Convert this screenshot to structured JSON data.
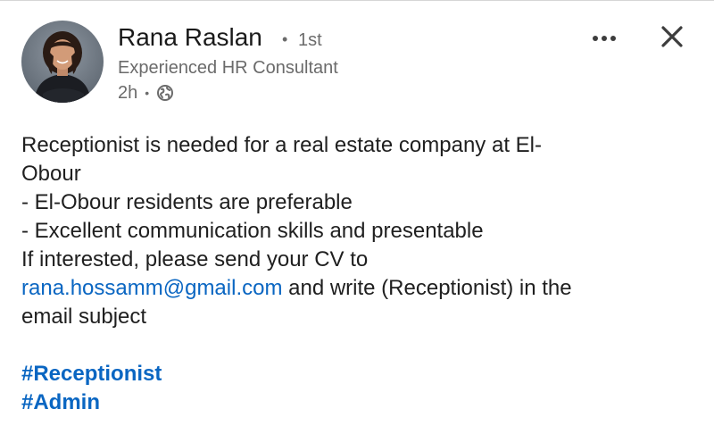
{
  "post": {
    "author": {
      "name": "Rana Raslan",
      "degree_separator": "•",
      "degree": "1st",
      "headline": "Experienced HR Consultant",
      "time": "2h",
      "time_separator": "•",
      "visibility_icon": "globe-icon"
    },
    "actions": {
      "more_icon": "more-horizontal-icon",
      "close_icon": "close-icon"
    },
    "body": {
      "line1": "Receptionist is needed for a real estate company at El-",
      "line2": "Obour",
      "line3": "- El-Obour residents are preferable",
      "line4": "- Excellent communication skills and presentable",
      "line5": "If interested, please send your CV to",
      "email": "rana.hossamm@gmail.com",
      "line6_rest": " and write (Receptionist) in the",
      "line7": "email subject"
    },
    "hashtags": [
      "#Receptionist",
      "#Admin"
    ]
  },
  "colors": {
    "link": "#0a66c2",
    "text": "#1f1f1f",
    "secondary_text": "#6b6b6b",
    "background": "#ffffff"
  }
}
